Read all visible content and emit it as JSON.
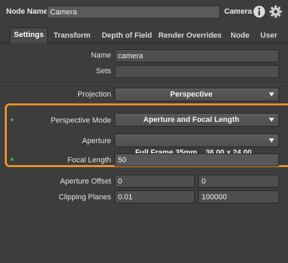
{
  "header": {
    "node_name_label": "Node Name",
    "node_name_value": "Camera",
    "node_type": "Camera",
    "info_icon": "info-icon",
    "settings_icon": "gear-icon"
  },
  "tabs": [
    {
      "label": "Settings",
      "active": true
    },
    {
      "label": "Transform",
      "active": false
    },
    {
      "label": "Depth of Field",
      "active": false
    },
    {
      "label": "Render Overrides",
      "active": false
    },
    {
      "label": "Node",
      "active": false
    },
    {
      "label": "User",
      "active": false
    }
  ],
  "fields": {
    "name": {
      "label": "Name",
      "value": "camera"
    },
    "sets": {
      "label": "Sets",
      "value": ""
    },
    "projection": {
      "label": "Projection",
      "value": "Perspective"
    },
    "perspective_mode": {
      "label": "Perspective Mode",
      "value": "Aperture and Focal Length",
      "modified_marker": "*"
    },
    "aperture": {
      "label": "Aperture",
      "value": "Full Frame 35mm    36.00 x 24.00"
    },
    "focal_length": {
      "label": "Focal Length",
      "value": "50",
      "modified_marker": "*"
    },
    "aperture_offset": {
      "label": "Aperture Offset",
      "x": "0",
      "y": "0"
    },
    "clipping_planes": {
      "label": "Clipping Planes",
      "near": "0.01",
      "far": "100000"
    }
  },
  "colors": {
    "highlight": "#f0902a",
    "modified_marker": "#4ad35a",
    "background": "#3d3d3d"
  }
}
